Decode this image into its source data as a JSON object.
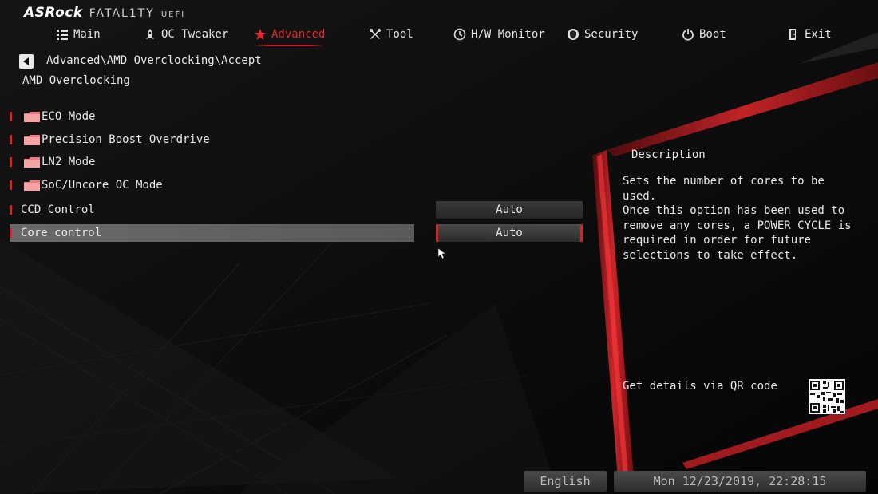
{
  "logo": {
    "brand": "ASRock",
    "series": "FATAL1TY",
    "suffix": "UEFI"
  },
  "nav": [
    {
      "label": "Main",
      "icon": "list-icon"
    },
    {
      "label": "OC Tweaker",
      "icon": "rocket-icon"
    },
    {
      "label": "Advanced",
      "icon": "star-icon",
      "active": true
    },
    {
      "label": "Tool",
      "icon": "tools-icon"
    },
    {
      "label": "H/W Monitor",
      "icon": "monitor-icon"
    },
    {
      "label": "Security",
      "icon": "shield-icon"
    },
    {
      "label": "Boot",
      "icon": "power-icon"
    },
    {
      "label": "Exit",
      "icon": "exit-icon"
    }
  ],
  "breadcrumb": "Advanced\\AMD Overclocking\\Accept",
  "page_title": "AMD Overclocking",
  "menu": [
    {
      "label": "ECO Mode",
      "type": "folder"
    },
    {
      "label": "Precision Boost Overdrive",
      "type": "folder"
    },
    {
      "label": "LN2 Mode",
      "type": "folder"
    },
    {
      "label": "SoC/Uncore OC Mode",
      "type": "folder"
    },
    {
      "label": "CCD Control",
      "type": "option",
      "value": "Auto"
    },
    {
      "label": "Core control",
      "type": "option",
      "value": "Auto",
      "selected": true
    }
  ],
  "description": {
    "title": "Description",
    "text": "Sets the number of cores to be used.\nOnce this option has been used to\nremove any cores, a POWER CYCLE is\nrequired in order for future\nselections to take effect.",
    "qr_label": "Get details via QR code"
  },
  "footer": {
    "language": "English",
    "datetime": "Mon 12/23/2019, 22:28:15"
  },
  "colors": {
    "accent": "#d3262a",
    "background": "#0b0b0c",
    "text": "#e8e8e8"
  }
}
